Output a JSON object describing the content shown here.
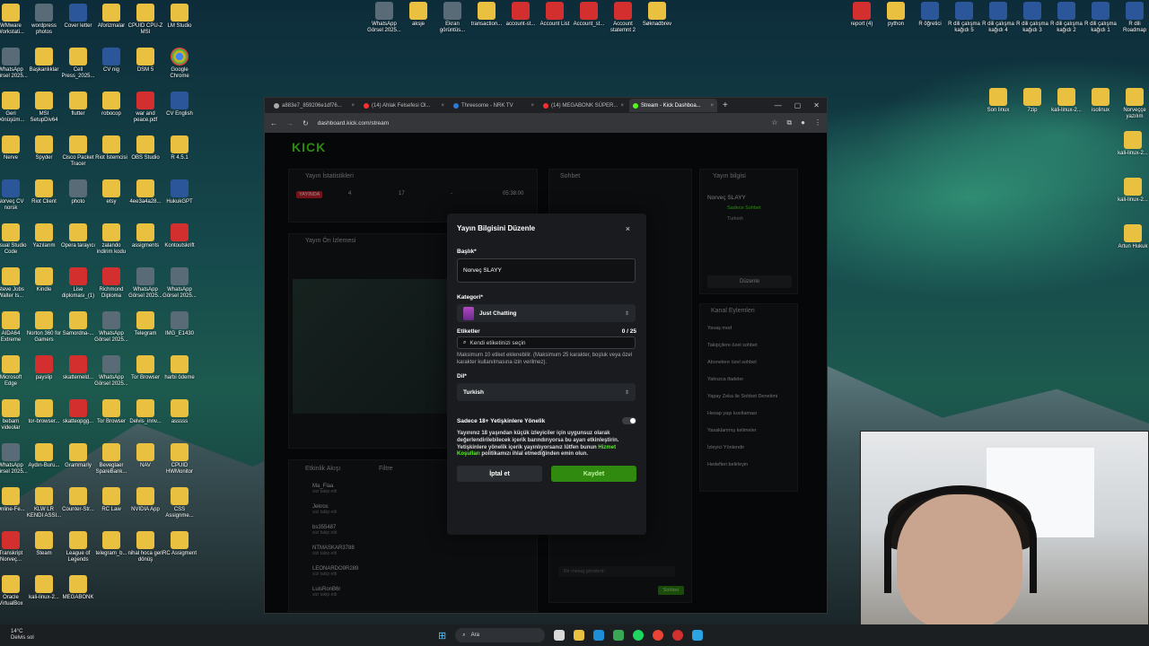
{
  "desktop": {
    "left_icons": [
      [
        "WMware Workstati...",
        "wordpress photos",
        "Cover letter",
        "Aforizmalar",
        "CPUID CPU-Z MSI",
        "LM Studio"
      ],
      [
        "WhatsApp Görsel 2025...",
        "Başkanlıklar",
        "Cell Press_2025...",
        "CV nig",
        "DSM 5",
        "Google Chrome"
      ],
      [
        "Geri Dönüşüm...",
        "MSI SetupDiv64",
        "flutter",
        "robocop",
        "war and peace.pdf",
        "CV English"
      ],
      [
        "Nerve",
        "Spyder",
        "Cisco Packet Tracer",
        "Riot İstemcisi",
        "OBS Studio",
        "R 4.5.1"
      ],
      [
        "Norveç CV norsk",
        "Riot Client",
        "photo",
        "etsy",
        "4ee3a4a28...",
        "HukukGPT"
      ],
      [
        "Visual Studio Code",
        "Yazılarım",
        "Opera tarayıcı",
        "zalando indirim kodu",
        "assigments",
        "Kontoutskrift"
      ],
      [
        "Steve Jobs Walter Is...",
        "Kindle",
        "Lise diploması_(1)",
        "Richmond Diploma",
        "WhatsApp Görsel 2025...",
        "WhatsApp Görsel 2025..."
      ],
      [
        "AIDA64 Extreme",
        "Norton 360 for Gamers",
        "Samordna-...",
        "WhatsApp Görsel 2025...",
        "Telegram",
        "IMG_E1430"
      ],
      [
        "Microsoft Edge",
        "payslip",
        "skattemeld...",
        "WhatsApp Görsel 2025...",
        "Tor Browser",
        "harbi ödeme"
      ],
      [
        "bebam videolar",
        "tor-browser...",
        "skatteopgg...",
        "Tor Browser",
        "Delvis_innv...",
        "asssss"
      ],
      [
        "WhatsApp Görsel 2025...",
        "Aydın-Buru...",
        "Grammarly",
        "Beveglaer SpareBank...",
        "NAV",
        "CPUID HWMonitor"
      ],
      [
        "Online-Fe...",
        "KLW LR KENDI ASSI...",
        "Counter-Str...",
        "RC Law",
        "NVIDIA App",
        "CSS Assignme..."
      ],
      [
        "Transkript Norveç...",
        "Steam",
        "League of Legends",
        "telegram_b...",
        "nihal hoca geri dönüş",
        "RC Assigment"
      ],
      [
        "Oracle VirtualBox",
        "kali-linux-2...",
        "MEGABONK"
      ]
    ],
    "top_icons": [
      "WhatsApp Görsel 2025...",
      "aksje",
      "Ekran görüntüs...",
      "transaction...",
      "account-st...",
      "Account List",
      "Account_st...",
      "Account statemnt 2",
      "Søknadbrev"
    ],
    "right_icons": [
      "report (4)",
      "python",
      "R öğretici",
      "R dili çalışma kağıdı 5",
      "R dili çalışma kağıdı 4",
      "R dili çalışma kağıdı 3",
      "R dili çalışma kağıdı 2",
      "R dili çalışma kağıdı 1",
      "R dili Roadmap"
    ],
    "right_icons_2": [
      "Son linux",
      "7zip",
      "kali-linux-2...",
      "isolinux",
      "Norveççe yazılım"
    ],
    "right_col": [
      "kali-linux-2...",
      "kali-linux-2...",
      "Artun Hukuk"
    ]
  },
  "browser": {
    "tabs": [
      {
        "label": "a883e7_859206e1df76...",
        "color": "#aaaaaa",
        "active": false
      },
      {
        "label": "(14) Ahlak Felsefesi Ol...",
        "color": "#ff2d2d",
        "active": false
      },
      {
        "label": "Threesome - NRK TV",
        "color": "#2a7ad6",
        "active": false
      },
      {
        "label": "(14) MEGABONK SÜPER...",
        "color": "#ff2d2d",
        "active": false
      },
      {
        "label": "Stream - Kick Dashboa...",
        "color": "#53fc18",
        "active": true
      }
    ],
    "new_tab": "+",
    "url": "dashboard.kick.com/stream",
    "win_controls": [
      "—",
      "▢",
      "✕"
    ]
  },
  "kick": {
    "logo": "KICK",
    "stats_title": "Yayın İstatistikleri",
    "live_badge": "YAYINDA",
    "stats": [
      "4",
      "17",
      "-",
      "05:38:00"
    ],
    "preview_title": "Yayın Ön İzlemesi",
    "chat_title": "Sohbet",
    "info_title": "Yayın bilgisi",
    "info_name": "Norveç SLAYY",
    "info_sub": "Sadece Sohbet",
    "info_lang": "Turkish",
    "edit_btn": "Düzenle",
    "activity_title": "Etkinlik Akışı",
    "filter": "Filtre",
    "actions_title": "Kanal Eylemleri",
    "actions": [
      "Yavaş mod",
      "Takipçilere özel sohbet",
      "Abonelere özel sohbet",
      "Yalnızca ifadeler",
      "Yapay Zeka ile Sohbet Denetimi",
      "Hesap yaşı kısıtlaması",
      "Yasaklanmış kelimeler",
      "İzleyici Yönlendir",
      "Hedefleri belirleyin"
    ],
    "activity": [
      "Ma_Flaa",
      "Jekros",
      "bs355487",
      "NTMASKAR3788",
      "LEONARDO9R289",
      "LuisRonB6r"
    ],
    "activity_sub": "sizi takip etti",
    "chat_placeholder": "Bir mesaj gönderin",
    "chat_send": "Sohbet"
  },
  "modal": {
    "title": "Yayın Bilgisini Düzenle",
    "close": "×",
    "title_label": "Başlık*",
    "title_value": "Norveç SLAYY",
    "category_label": "Kategori*",
    "category_value": "Just Chatting",
    "tags_label": "Etiketler",
    "tags_count": "0 / 25",
    "tags_placeholder": "Kendi etiketinizi seçin",
    "tags_hint": "Maksimum 10 etiket eklenebilir. (Maksimum 25 karakter, boşluk veya özel karakter kullanılmasına izin verilmez).",
    "language_label": "Dil*",
    "language_value": "Turkish",
    "adult_label": "Sadece 18+ Yetişkinlere Yönelik",
    "adult_warning_1": "Yayınınız 18 yaşından küçük izleyiciler için uygunsuz olarak değerlendirilebilecek içerik barındırıyorsa bu ayarı etkinleştirin. Yetişkinlere yönelik içerik yayınlıyorsanız lütfen bunun ",
    "adult_warning_link": "Hizmet Koşulları",
    "adult_warning_2": " politikamızı ihlal etmediğinden emin olun.",
    "cancel": "İptal et",
    "save": "Kaydet"
  },
  "taskbar": {
    "temp": "14°C",
    "weather": "Delvis sol",
    "search": "Ara"
  }
}
